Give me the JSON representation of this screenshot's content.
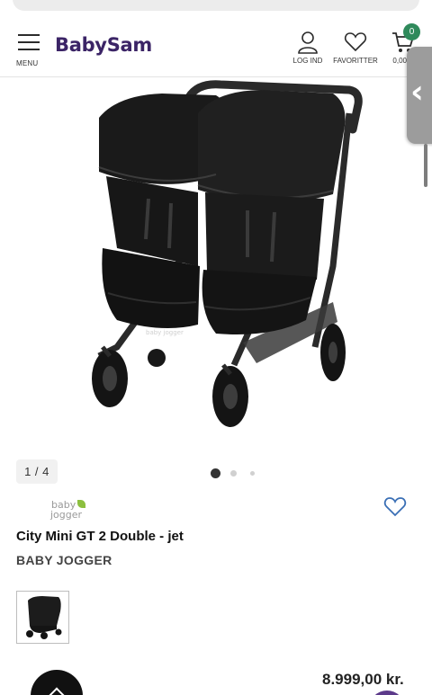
{
  "header": {
    "logo": "BabySam",
    "menu_label": "MENU",
    "login_label": "LOG IND",
    "favorites_label": "FAVORITTER",
    "cart_label": "0,00 K",
    "cart_count": "0",
    "icons": {
      "menu": "hamburger-icon",
      "login": "user-icon",
      "favorites": "heart-icon",
      "cart": "cart-icon"
    }
  },
  "gallery": {
    "counter": "1 / 4",
    "total_images": 4,
    "active_index": 1
  },
  "product": {
    "brand_logo_line1": "baby",
    "brand_logo_line2": "jogger",
    "title": "City Mini GT 2 Double - jet",
    "brand": "BABY JOGGER",
    "image_logo_text": "baby jogger",
    "price": "8.999,00 kr."
  },
  "colors": {
    "brand": "#3b2466",
    "badge": "#2f8a5b",
    "side_tab": "#9c9c9c",
    "stroller": "#1f1f1f"
  }
}
